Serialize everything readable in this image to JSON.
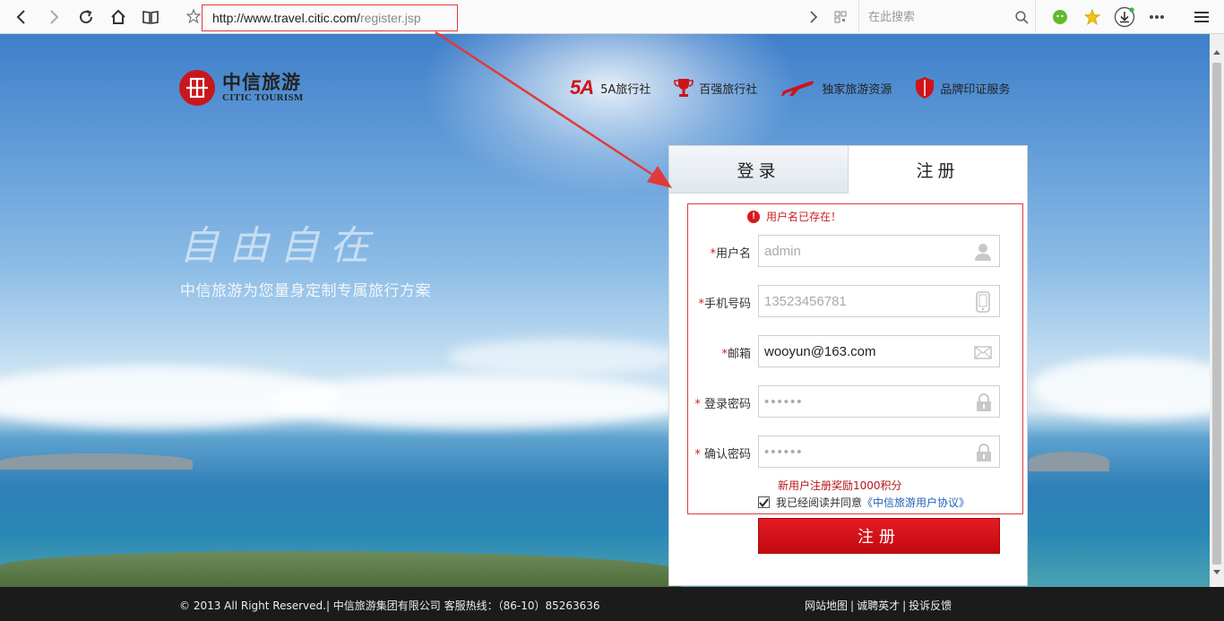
{
  "browser": {
    "url_base": "http://www.travel.citic.com/",
    "url_path": "register.jsp",
    "search_placeholder": "在此搜索"
  },
  "brand": {
    "name_cn": "中信旅游",
    "name_en": "CITIC TOURISM"
  },
  "features": [
    {
      "badge": "5A",
      "label": "5A旅行社",
      "icon": "5a-badge-icon"
    },
    {
      "label": "百强旅行社",
      "icon": "trophy-icon"
    },
    {
      "label": "独家旅游资源",
      "icon": "airplane-icon"
    },
    {
      "label": "品牌印证服务",
      "icon": "shield-icon"
    }
  ],
  "hero": {
    "slogan": "自由自在",
    "subtitle": "中信旅游为您量身定制专属旅行方案"
  },
  "tabs": {
    "login": "登录",
    "register": "注册"
  },
  "form": {
    "error_message": "用户名已存在！",
    "required_mark": "*",
    "username": {
      "label": "用户名",
      "value": "admin"
    },
    "phone": {
      "label": "手机号码",
      "value": "13523456781"
    },
    "email": {
      "label": "邮箱",
      "value": "wooyun@163.com"
    },
    "password": {
      "label": " 登录密码",
      "value": "••••••"
    },
    "confirm": {
      "label": " 确认密码",
      "value": "••••••"
    },
    "bonus_text": "新用户注册奖励1000积分",
    "agree_text": "我已经阅读并同意",
    "agree_link": "《中信旅游用户协议》",
    "agree_checked": true,
    "submit": "注册"
  },
  "footer": {
    "copyright": "© 2013 All Right Reserved.| 中信旅游集团有限公司 客服热线：（86-10）85263636",
    "links": [
      "网站地图",
      "诚聘英才",
      "投诉反馈"
    ],
    "separator": "|"
  },
  "colors": {
    "brand_red": "#d0121b",
    "annotation_red": "#e03a3a",
    "link_blue": "#2363b6"
  }
}
